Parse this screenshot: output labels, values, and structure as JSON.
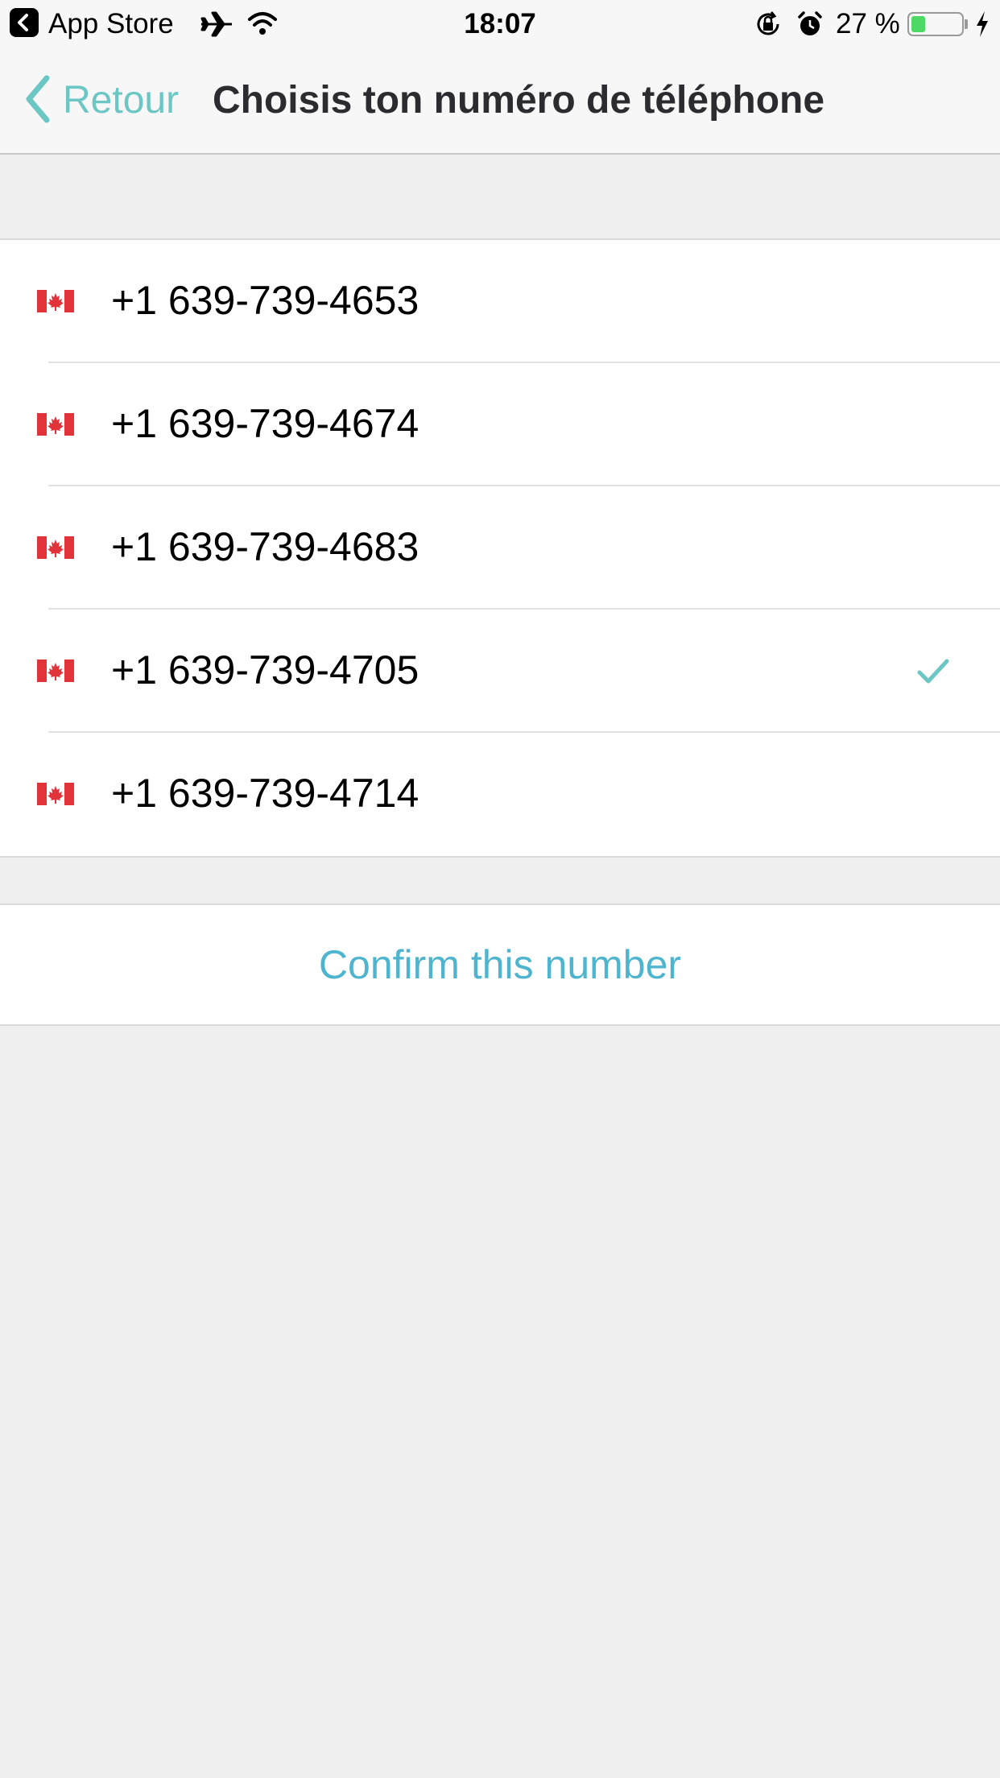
{
  "status_bar": {
    "back_app_label": "App Store",
    "time": "18:07",
    "battery_percent_text": "27 %",
    "battery_level": 0.27,
    "icons": [
      "back-arrow-icon",
      "airplane-icon",
      "wifi-icon",
      "orientation-lock-icon",
      "alarm-icon",
      "battery-icon",
      "charging-bolt-icon"
    ]
  },
  "nav": {
    "back_label": "Retour",
    "title": "Choisis ton numéro de téléphone",
    "accent_color": "#6cc6c4"
  },
  "numbers": [
    {
      "flag": "canada-flag-icon",
      "number": "+1 639-739-4653",
      "selected": false
    },
    {
      "flag": "canada-flag-icon",
      "number": "+1 639-739-4674",
      "selected": false
    },
    {
      "flag": "canada-flag-icon",
      "number": "+1 639-739-4683",
      "selected": false
    },
    {
      "flag": "canada-flag-icon",
      "number": "+1 639-739-4705",
      "selected": true
    },
    {
      "flag": "canada-flag-icon",
      "number": "+1 639-739-4714",
      "selected": false
    }
  ],
  "confirm": {
    "label": "Confirm this number",
    "color": "#4fb5cf"
  }
}
